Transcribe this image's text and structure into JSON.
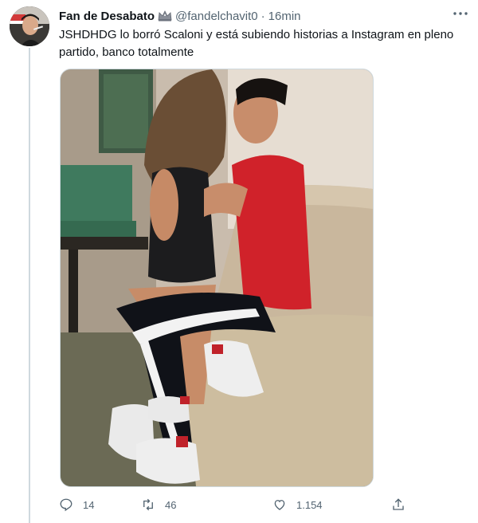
{
  "tweet": {
    "author": {
      "display_name": "Fan de Desabato",
      "badge_icon": "crown-emoji-icon",
      "handle": "@fandelchavit0"
    },
    "separator": "·",
    "time": "16min",
    "more_icon": "more-horizontal-icon",
    "text": "JSHDHDG lo borró Scaloni y está subiendo historias a Instagram en pleno partido, banco totalmente",
    "media": {
      "type": "photo"
    },
    "actions": {
      "replies": "14",
      "retweets": "46",
      "likes": "1.154",
      "reply_icon": "reply-icon",
      "retweet_icon": "retweet-icon",
      "like_icon": "heart-icon",
      "share_icon": "share-icon"
    }
  },
  "colors": {
    "text_primary": "#0f1419",
    "text_secondary": "#536471",
    "border": "#cfd9de"
  }
}
